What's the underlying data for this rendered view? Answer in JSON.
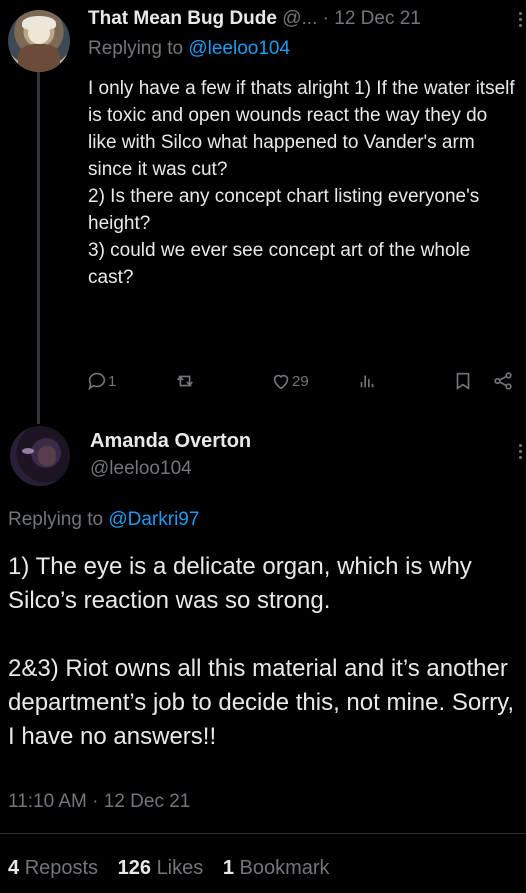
{
  "reply_tweet": {
    "author_name": "That Mean Bug Dude",
    "author_handle": "@...",
    "separator": "·",
    "date": "12 Dec 21",
    "replying_prefix": "Replying to ",
    "replying_to": "@leeloo104",
    "body": "I only have a few if thats alright 1) If the water itself is toxic and open wounds react the way they do like with Silco what happened to Vander's arm since it was cut?\n2) Is there any concept chart listing everyone's height?\n3) could we ever see concept art of the whole cast?",
    "reply_count": "1",
    "like_count": "29"
  },
  "main_tweet": {
    "author_name": "Amanda Overton",
    "author_handle": "@leeloo104",
    "replying_prefix": "Replying to ",
    "replying_to": "@Darkri97",
    "body": "1) The eye is a delicate organ, which is why Silco’s reaction was so strong.\n\n2&3) Riot owns all this material and it’s another department’s job to decide this, not mine. Sorry, I have no answers!!",
    "timestamp": "11:10 AM · 12 Dec 21",
    "reposts_count": "4",
    "reposts_label": "Reposts",
    "likes_count": "126",
    "likes_label": "Likes",
    "bookmarks_count": "1",
    "bookmarks_label": "Bookmark"
  },
  "colors": {
    "background": "#000000",
    "text_primary": "#e7e9ea",
    "text_secondary": "#71767b",
    "accent": "#1d9bf0"
  },
  "icons": [
    "reply-icon",
    "repost-icon",
    "like-icon",
    "views-icon",
    "bookmark-icon",
    "share-icon",
    "more-icon"
  ]
}
